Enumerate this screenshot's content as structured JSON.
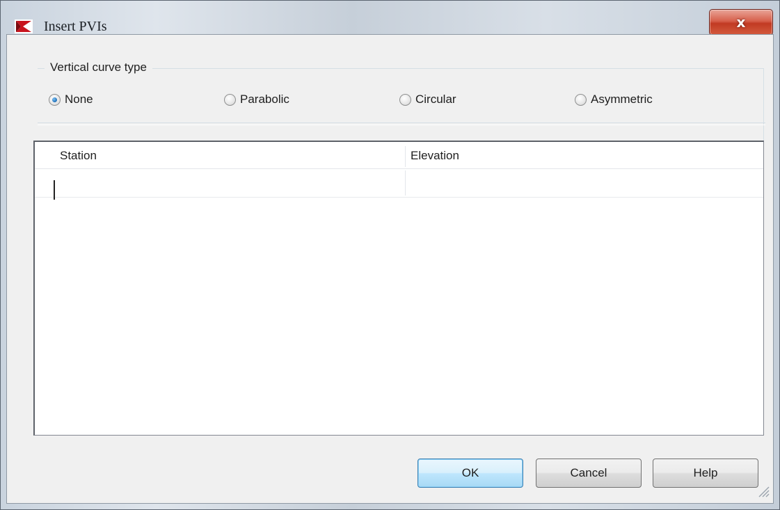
{
  "window": {
    "title": "Insert PVIs",
    "close_label": "x"
  },
  "vertical_curve": {
    "legend": "Vertical curve type",
    "options": [
      {
        "label": "None",
        "checked": true
      },
      {
        "label": "Parabolic",
        "checked": false
      },
      {
        "label": "Circular",
        "checked": false
      },
      {
        "label": "Asymmetric",
        "checked": false
      }
    ]
  },
  "table": {
    "columns": [
      "Station",
      "Elevation"
    ],
    "rows": [
      [
        "",
        ""
      ]
    ]
  },
  "buttons": {
    "ok": "OK",
    "cancel": "Cancel",
    "help": "Help"
  }
}
